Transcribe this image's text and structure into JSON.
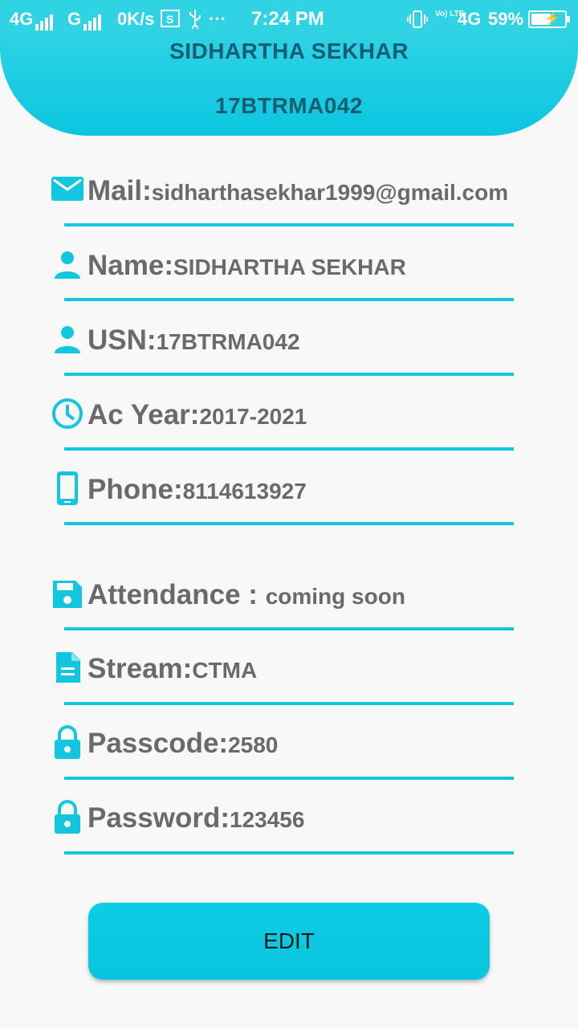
{
  "status_bar": {
    "network1": "4G",
    "network2": "G",
    "speed": "0K/s",
    "more": "···",
    "time": "7:24 PM",
    "volte": "Vo) LTE",
    "network3": "4G",
    "battery": "59%",
    "battery_level": 0.59
  },
  "header": {
    "name": "SIDHARTHA SEKHAR",
    "usn": "17BTRMA042"
  },
  "fields": [
    {
      "icon": "mail-icon",
      "label": "Mail:",
      "value": "sidharthasekhar1999@gmail.com"
    },
    {
      "icon": "person-icon",
      "label": "Name:",
      "value": "SIDHARTHA SEKHAR"
    },
    {
      "icon": "person-icon",
      "label": "USN:",
      "value": "17BTRMA042"
    },
    {
      "icon": "clock-icon",
      "label": "Ac Year:",
      "value": "2017-2021"
    },
    {
      "icon": "phone-icon",
      "label": "Phone:",
      "value": "8114613927"
    },
    {
      "icon": "save-icon",
      "label": "Attendance : ",
      "value": "coming soon"
    },
    {
      "icon": "document-icon",
      "label": "Stream:",
      "value": "CTMA"
    },
    {
      "icon": "lock-icon",
      "label": "Passcode:",
      "value": "2580"
    },
    {
      "icon": "lock-icon",
      "label": "Password:",
      "value": "123456"
    }
  ],
  "edit_button": "EDIT",
  "colors": {
    "accent": "#0bc6e0",
    "header_text": "#155e72",
    "field_text": "#6a6a6a"
  }
}
